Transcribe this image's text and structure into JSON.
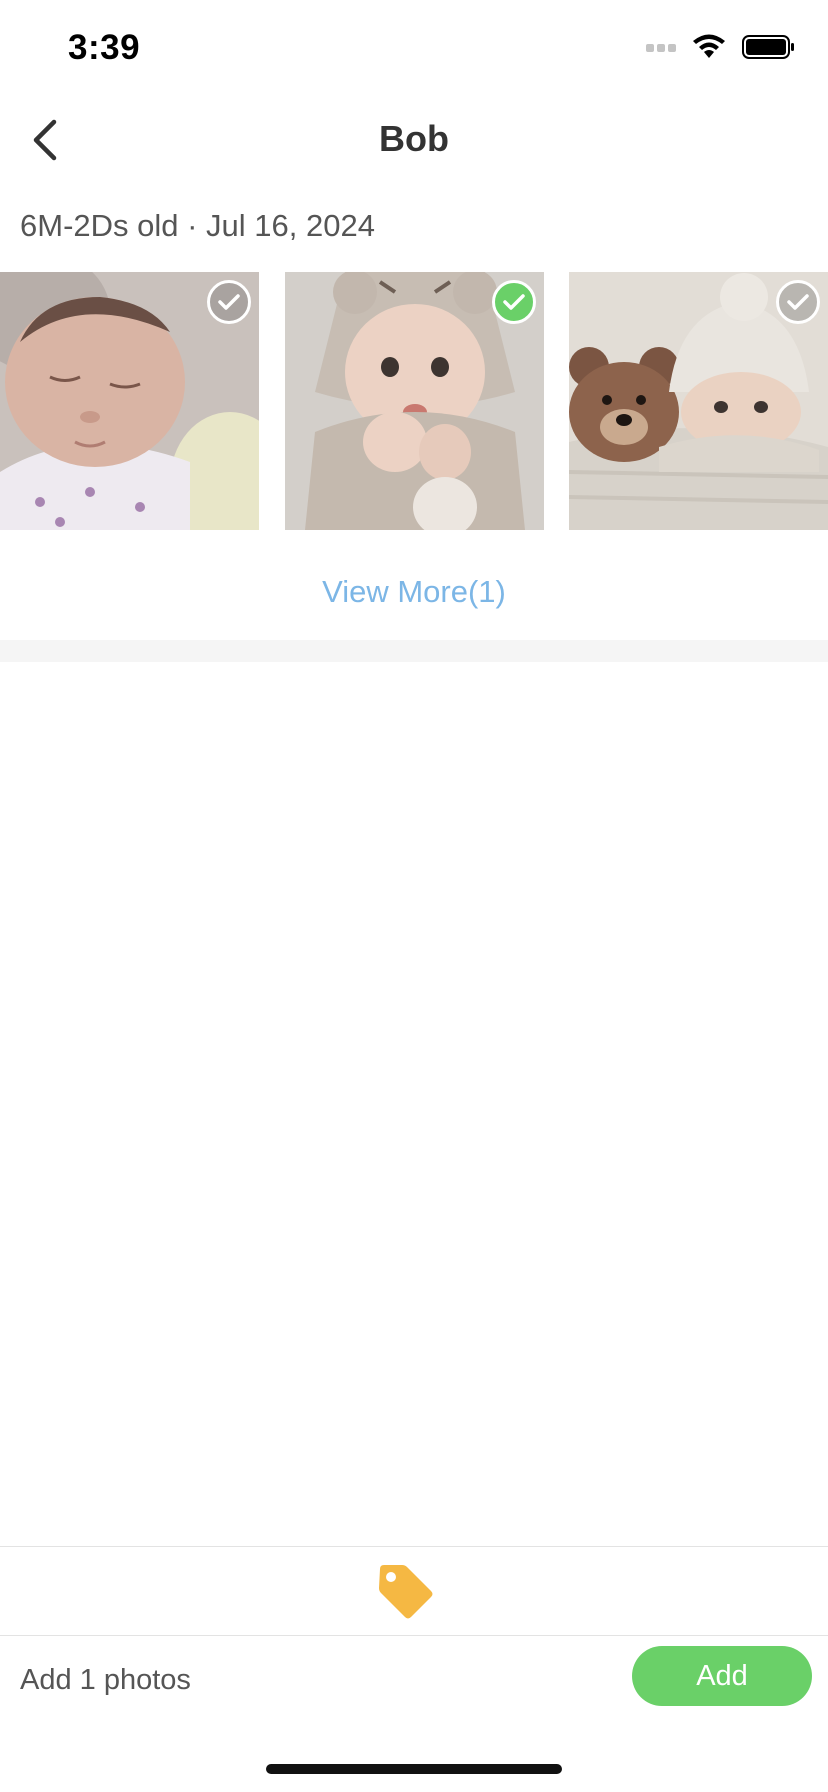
{
  "status_bar": {
    "time": "3:39"
  },
  "nav": {
    "title": "Bob"
  },
  "header": {
    "age_date": "6M-2Ds old · Jul 16, 2024"
  },
  "photos": [
    {
      "name": "Newborn sleeping",
      "selected": false
    },
    {
      "name": "Baby in bear hood",
      "selected": true
    },
    {
      "name": "Baby with teddy bear",
      "selected": false
    }
  ],
  "view_more": {
    "label": "View More(1)"
  },
  "bottom": {
    "count_label": "Add 1 photos",
    "add_label": "Add"
  },
  "colors": {
    "accent_green": "#6ad068",
    "link_blue": "#7cb6e6",
    "tag_orange": "#f5b843"
  }
}
